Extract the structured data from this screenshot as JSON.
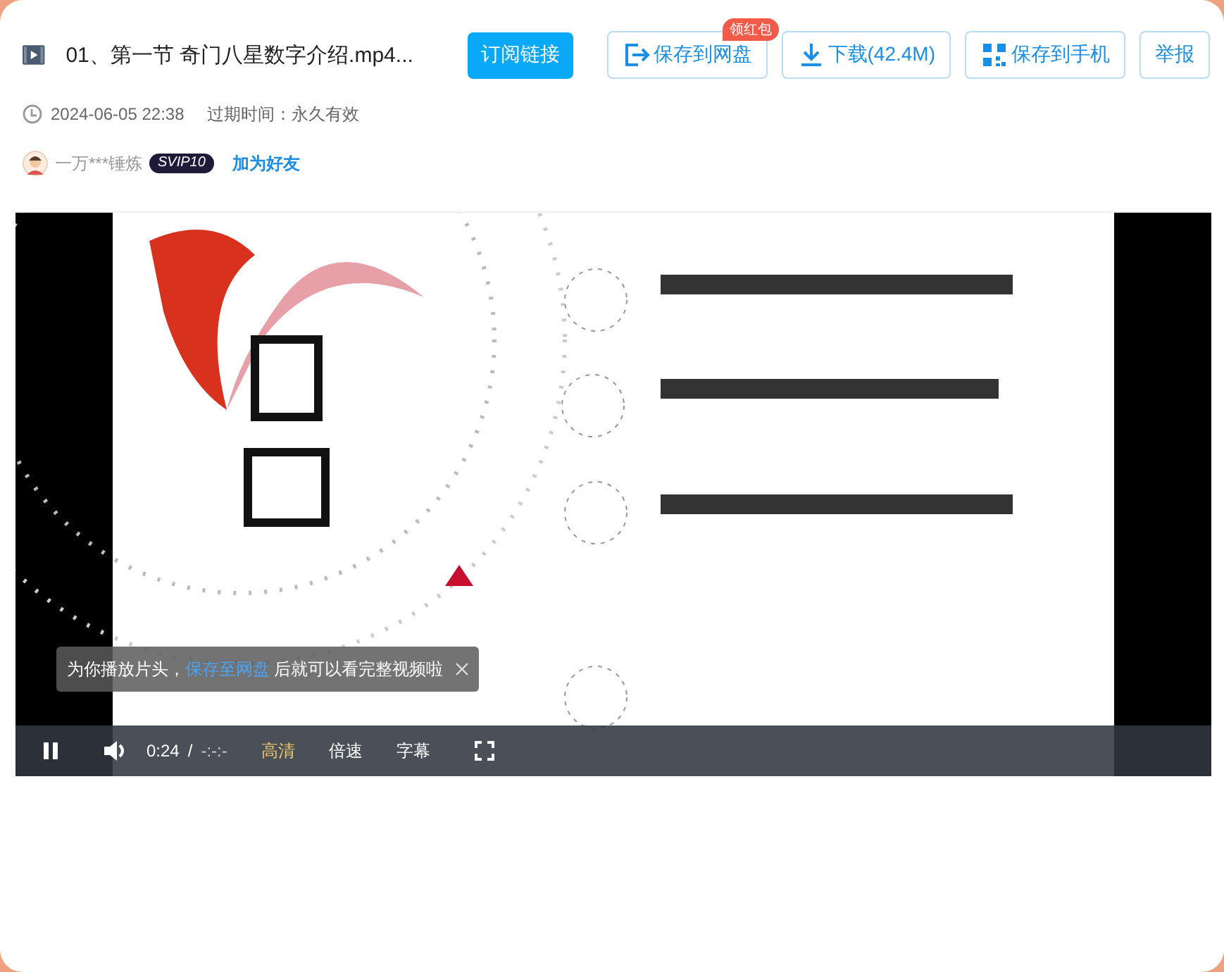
{
  "file": {
    "title": "01、第一节 奇门八星数字介绍.mp4...",
    "subscribe_button": "订阅链接",
    "actions": [
      {
        "kind": "save",
        "label": "保存到网盘",
        "badge": "领红包"
      },
      {
        "kind": "download",
        "label": "下载(42.4M)"
      },
      {
        "kind": "phone",
        "label": "保存到手机"
      },
      {
        "kind": "report",
        "label": "举报"
      }
    ]
  },
  "meta": {
    "date": "2024-06-05 22:38",
    "expiry": "过期时间：永久有效"
  },
  "user": {
    "name": "一万***锤炼",
    "badge": "SVIP10",
    "add_friend": "加为好友"
  },
  "player": {
    "kind": "picture",
    "playing": true,
    "toast": {
      "before": "为你播放片头，",
      "link": "保存至网盘",
      "after": "后就可以看完整视频啦"
    },
    "time": "0:24",
    "separator": "/",
    "duration": "-:-:-",
    "quality": "高清",
    "speed": "倍速",
    "subtitles": "字幕"
  }
}
